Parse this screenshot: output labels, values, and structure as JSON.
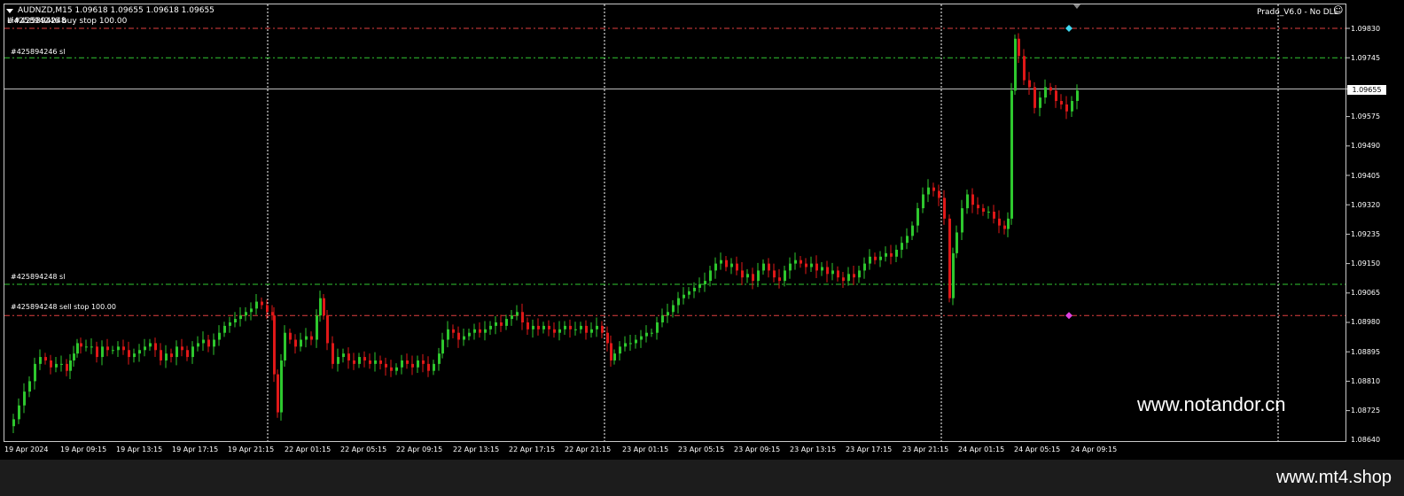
{
  "header": {
    "symbol_line": "AUDNZD,M15  1.09618 1.09655 1.09618 1.09655",
    "order_line": "#425894246 buy stop 100.00",
    "order_line_overlap": "Li#425894248",
    "indicator": "Prado_V6.0 - No DLL"
  },
  "orders": [
    {
      "label": "#425894246 sl"
    },
    {
      "label": "#425894248 sl"
    },
    {
      "label": "#425894248 sell stop 100.00"
    }
  ],
  "price_axis": {
    "labels": [
      "1.09830",
      "1.09745",
      "1.09575",
      "1.09490",
      "1.09405",
      "1.09320",
      "1.09235",
      "1.09150",
      "1.09065",
      "1.08980",
      "1.08895",
      "1.08810",
      "1.08725",
      "1.08640"
    ],
    "current": "1.09655"
  },
  "time_axis": {
    "labels": [
      "19 Apr 2024",
      "19 Apr 09:15",
      "19 Apr 13:15",
      "19 Apr 17:15",
      "19 Apr 21:15",
      "22 Apr 01:15",
      "22 Apr 05:15",
      "22 Apr 09:15",
      "22 Apr 13:15",
      "22 Apr 17:15",
      "22 Apr 21:15",
      "23 Apr 01:15",
      "23 Apr 05:15",
      "23 Apr 09:15",
      "23 Apr 13:15",
      "23 Apr 17:15",
      "23 Apr 21:15",
      "24 Apr 01:15",
      "24 Apr 05:15",
      "24 Apr 09:15"
    ]
  },
  "watermark": "www.notandor.cn",
  "footer": {
    "brand": "www.mt4.shop"
  },
  "colors": {
    "bull": "#2ec82e",
    "bear": "#e01818",
    "sl_line": "#32c832",
    "stop_line": "#e04040",
    "grid": "#ffffff"
  },
  "chart_data": {
    "type": "candlestick",
    "symbol": "AUDNZD",
    "timeframe": "M15",
    "ylim": [
      1.0864,
      1.0983
    ],
    "close_path": [
      [
        0,
        1.0868
      ],
      [
        6,
        1.087
      ],
      [
        12,
        1.0874
      ],
      [
        18,
        1.0878
      ],
      [
        24,
        1.0881
      ],
      [
        30,
        1.0886
      ],
      [
        36,
        1.0888
      ],
      [
        42,
        1.0887
      ],
      [
        48,
        1.0885
      ],
      [
        54,
        1.0886
      ],
      [
        60,
        1.0886
      ],
      [
        66,
        1.0884
      ],
      [
        70,
        1.0887
      ],
      [
        74,
        1.0889
      ],
      [
        78,
        1.0892
      ],
      [
        82,
        1.0891
      ],
      [
        88,
        1.0891
      ],
      [
        94,
        1.0891
      ],
      [
        100,
        1.0888
      ],
      [
        106,
        1.0891
      ],
      [
        112,
        1.089
      ],
      [
        118,
        1.089
      ],
      [
        124,
        1.0891
      ],
      [
        130,
        1.089
      ],
      [
        136,
        1.0888
      ],
      [
        142,
        1.0889
      ],
      [
        148,
        1.089
      ],
      [
        154,
        1.0891
      ],
      [
        160,
        1.0892
      ],
      [
        166,
        1.089
      ],
      [
        172,
        1.0887
      ],
      [
        178,
        1.0889
      ],
      [
        184,
        1.0888
      ],
      [
        190,
        1.0891
      ],
      [
        196,
        1.089
      ],
      [
        202,
        1.0888
      ],
      [
        208,
        1.0891
      ],
      [
        214,
        1.0892
      ],
      [
        220,
        1.0893
      ],
      [
        226,
        1.0891
      ],
      [
        232,
        1.0893
      ],
      [
        238,
        1.0895
      ],
      [
        244,
        1.0897
      ],
      [
        250,
        1.0898
      ],
      [
        256,
        1.0899
      ],
      [
        262,
        1.09
      ],
      [
        268,
        1.0901
      ],
      [
        274,
        1.0902
      ],
      [
        280,
        1.0904
      ],
      [
        286,
        1.0903
      ],
      [
        292,
        1.0901
      ],
      [
        298,
        1.09
      ],
      [
        300,
        1.0883
      ],
      [
        304,
        1.0872
      ],
      [
        308,
        1.0887
      ],
      [
        312,
        1.0895
      ],
      [
        318,
        1.0893
      ],
      [
        324,
        1.0891
      ],
      [
        330,
        1.0893
      ],
      [
        336,
        1.0894
      ],
      [
        342,
        1.0893
      ],
      [
        348,
        1.09
      ],
      [
        352,
        1.0905
      ],
      [
        356,
        1.09
      ],
      [
        360,
        1.0892
      ],
      [
        366,
        1.0886
      ],
      [
        372,
        1.0888
      ],
      [
        378,
        1.0889
      ],
      [
        384,
        1.0887
      ],
      [
        390,
        1.0886
      ],
      [
        396,
        1.0888
      ],
      [
        402,
        1.0887
      ],
      [
        408,
        1.0886
      ],
      [
        414,
        1.0887
      ],
      [
        420,
        1.0886
      ],
      [
        426,
        1.0885
      ],
      [
        432,
        1.0884
      ],
      [
        438,
        1.0885
      ],
      [
        444,
        1.0887
      ],
      [
        450,
        1.0886
      ],
      [
        456,
        1.0885
      ],
      [
        462,
        1.0887
      ],
      [
        468,
        1.0886
      ],
      [
        474,
        1.0884
      ],
      [
        480,
        1.0886
      ],
      [
        486,
        1.0889
      ],
      [
        490,
        1.0893
      ],
      [
        496,
        1.0896
      ],
      [
        502,
        1.0895
      ],
      [
        508,
        1.0893
      ],
      [
        514,
        1.0894
      ],
      [
        520,
        1.0895
      ],
      [
        526,
        1.0896
      ],
      [
        532,
        1.0895
      ],
      [
        538,
        1.0896
      ],
      [
        544,
        1.0897
      ],
      [
        550,
        1.0898
      ],
      [
        556,
        1.0897
      ],
      [
        562,
        1.0899
      ],
      [
        568,
        1.09
      ],
      [
        574,
        1.0901
      ],
      [
        580,
        1.0898
      ],
      [
        586,
        1.0896
      ],
      [
        592,
        1.0897
      ],
      [
        598,
        1.0896
      ],
      [
        604,
        1.0897
      ],
      [
        610,
        1.0896
      ],
      [
        616,
        1.0895
      ],
      [
        622,
        1.0896
      ],
      [
        628,
        1.0897
      ],
      [
        634,
        1.0896
      ],
      [
        640,
        1.0896
      ],
      [
        646,
        1.0897
      ],
      [
        652,
        1.0895
      ],
      [
        658,
        1.0896
      ],
      [
        664,
        1.0897
      ],
      [
        670,
        1.0895
      ],
      [
        676,
        1.0892
      ],
      [
        680,
        1.0887
      ],
      [
        684,
        1.0889
      ],
      [
        690,
        1.0891
      ],
      [
        696,
        1.0892
      ],
      [
        702,
        1.0892
      ],
      [
        708,
        1.0893
      ],
      [
        714,
        1.0894
      ],
      [
        720,
        1.0895
      ],
      [
        726,
        1.0895
      ],
      [
        732,
        1.0898
      ],
      [
        738,
        1.09
      ],
      [
        744,
        1.0901
      ],
      [
        750,
        1.0903
      ],
      [
        756,
        1.0905
      ],
      [
        762,
        1.0906
      ],
      [
        768,
        1.0907
      ],
      [
        774,
        1.0908
      ],
      [
        780,
        1.0909
      ],
      [
        786,
        1.091
      ],
      [
        792,
        1.0913
      ],
      [
        798,
        1.0915
      ],
      [
        804,
        1.0916
      ],
      [
        810,
        1.0914
      ],
      [
        816,
        1.0915
      ],
      [
        822,
        1.0913
      ],
      [
        828,
        1.0911
      ],
      [
        834,
        1.0912
      ],
      [
        840,
        1.091
      ],
      [
        846,
        1.0913
      ],
      [
        852,
        1.0915
      ],
      [
        858,
        1.0913
      ],
      [
        864,
        1.0911
      ],
      [
        870,
        1.091
      ],
      [
        876,
        1.0913
      ],
      [
        882,
        1.0915
      ],
      [
        888,
        1.0916
      ],
      [
        894,
        1.0915
      ],
      [
        900,
        1.0914
      ],
      [
        906,
        1.0915
      ],
      [
        912,
        1.0913
      ],
      [
        918,
        1.0914
      ],
      [
        924,
        1.0912
      ],
      [
        930,
        1.0913
      ],
      [
        936,
        1.0911
      ],
      [
        942,
        1.091
      ],
      [
        948,
        1.0912
      ],
      [
        954,
        1.0911
      ],
      [
        960,
        1.0913
      ],
      [
        966,
        1.0915
      ],
      [
        972,
        1.0917
      ],
      [
        978,
        1.0916
      ],
      [
        984,
        1.0917
      ],
      [
        990,
        1.0918
      ],
      [
        996,
        1.0917
      ],
      [
        1002,
        1.0919
      ],
      [
        1008,
        1.0921
      ],
      [
        1014,
        1.0923
      ],
      [
        1020,
        1.0926
      ],
      [
        1026,
        1.0931
      ],
      [
        1032,
        1.0935
      ],
      [
        1038,
        1.0937
      ],
      [
        1044,
        1.0936
      ],
      [
        1050,
        1.0934
      ],
      [
        1056,
        1.0928
      ],
      [
        1062,
        1.0905
      ],
      [
        1066,
        1.0918
      ],
      [
        1070,
        1.0924
      ],
      [
        1076,
        1.0931
      ],
      [
        1082,
        1.0935
      ],
      [
        1088,
        1.0932
      ],
      [
        1094,
        1.0931
      ],
      [
        1100,
        1.093
      ],
      [
        1106,
        1.093
      ],
      [
        1112,
        1.0928
      ],
      [
        1118,
        1.0926
      ],
      [
        1124,
        1.0925
      ],
      [
        1128,
        1.0928
      ],
      [
        1132,
        1.0965
      ],
      [
        1136,
        1.098
      ],
      [
        1140,
        1.0975
      ],
      [
        1146,
        1.0968
      ],
      [
        1152,
        1.0966
      ],
      [
        1158,
        1.096
      ],
      [
        1164,
        1.0963
      ],
      [
        1170,
        1.0966
      ],
      [
        1176,
        1.0965
      ],
      [
        1182,
        1.0962
      ],
      [
        1188,
        1.0961
      ],
      [
        1194,
        1.0959
      ],
      [
        1200,
        1.0962
      ],
      [
        1206,
        1.0965
      ]
    ],
    "order_levels": {
      "buy_stop": 1.0983,
      "buy_sl": 1.09745,
      "sell_sl": 1.0909,
      "sell_stop": 1.09,
      "current": 1.09655
    }
  }
}
